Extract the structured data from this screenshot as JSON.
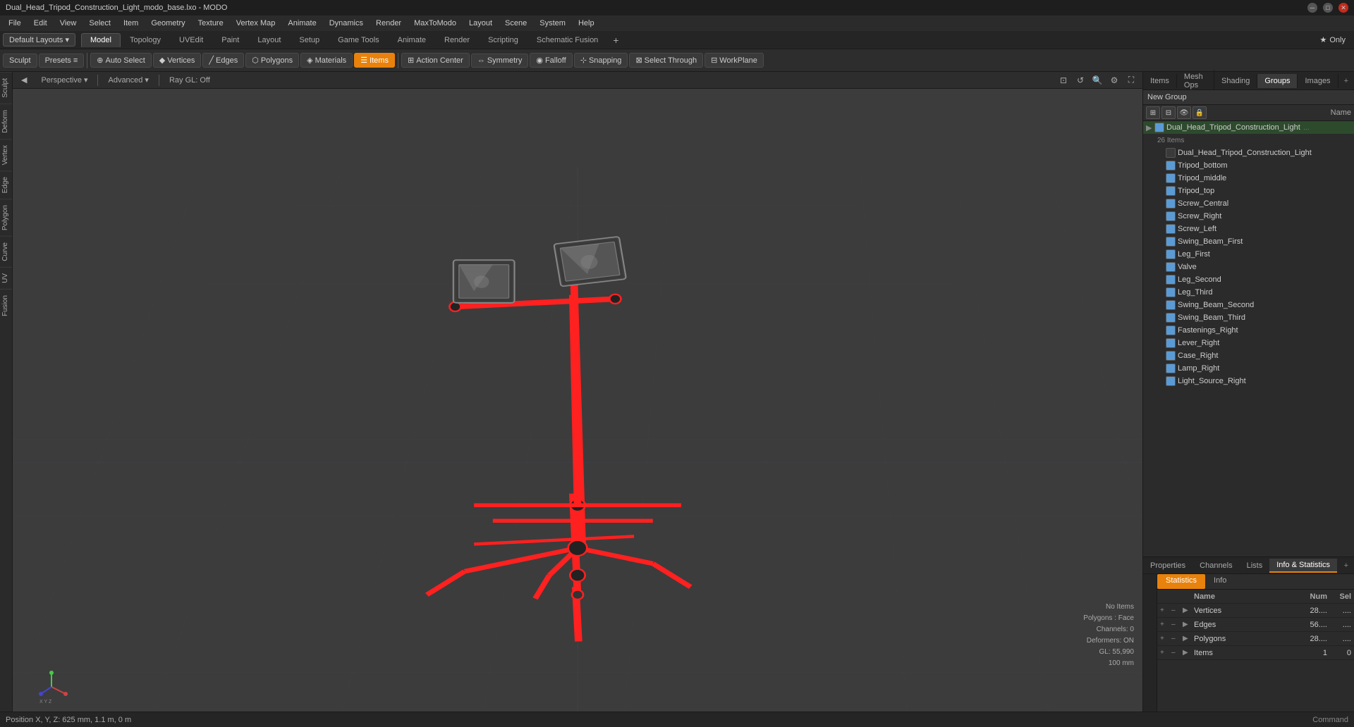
{
  "titlebar": {
    "title": "Dual_Head_Tripod_Construction_Light_modo_base.lxo - MODO",
    "controls": [
      "minimize",
      "maximize",
      "close"
    ]
  },
  "menubar": {
    "items": [
      "File",
      "Edit",
      "View",
      "Select",
      "Item",
      "Geometry",
      "Texture",
      "Vertex Map",
      "Animate",
      "Dynamics",
      "Render",
      "MaxToModo",
      "Layout",
      "Scene",
      "System",
      "Help"
    ]
  },
  "layoutbar": {
    "dropdown_label": "Default Layouts ▾",
    "tabs": [
      "Model",
      "Topology",
      "UVEdit",
      "Paint",
      "Layout",
      "Setup",
      "Game Tools",
      "Animate",
      "Render",
      "Scripting",
      "Schematic Fusion"
    ],
    "active_tab": "Model",
    "add_label": "+",
    "star_label": "★ Only"
  },
  "toolbar": {
    "sculpt_label": "Sculpt",
    "presets_label": "Presets",
    "presets_toggle": "III",
    "auto_select_label": "Auto Select",
    "vertices_label": "Vertices",
    "edges_label": "Edges",
    "polygons_label": "Polygons",
    "materials_label": "Materials",
    "items_label": "Items",
    "action_center_label": "Action Center",
    "symmetry_label": "Symmetry",
    "falloff_label": "Falloff",
    "snapping_label": "Snapping",
    "select_through_label": "Select Through",
    "workplane_label": "WorkPlane"
  },
  "viewport": {
    "view_label": "Perspective",
    "advanced_label": "Advanced",
    "ray_gl_label": "Ray GL: Off",
    "icons": [
      "fit-icon",
      "zoom-in-icon",
      "zoom-out-icon",
      "settings-icon",
      "expand-icon"
    ]
  },
  "left_sidebar": {
    "tabs": [
      "Sculpt",
      "Deform",
      "Vertex",
      "Edge",
      "Polygon",
      "Curve",
      "UV",
      "Fusion"
    ]
  },
  "right_panel": {
    "tabs": [
      "Items",
      "Mesh Ops",
      "Shading",
      "Groups",
      "Images"
    ],
    "active_tab": "Groups",
    "add_label": "+",
    "new_group_label": "New Group",
    "name_col": "Name",
    "groups": [
      {
        "label": "Dual_Head_Tripod_Construction_Light",
        "type": "group",
        "expanded": true,
        "selected": false,
        "children": [
          {
            "label": "26 Items",
            "type": "subheader"
          },
          {
            "label": "Dual_Head_Tripod_Construction_Light",
            "type": "item",
            "checked": false
          },
          {
            "label": "Tripod_bottom",
            "type": "item",
            "checked": true
          },
          {
            "label": "Tripod_middle",
            "type": "item",
            "checked": true
          },
          {
            "label": "Tripod_top",
            "type": "item",
            "checked": true
          },
          {
            "label": "Screw_Central",
            "type": "item",
            "checked": true
          },
          {
            "label": "Screw_Right",
            "type": "item",
            "checked": true
          },
          {
            "label": "Screw_Left",
            "type": "item",
            "checked": true
          },
          {
            "label": "Swing_Beam_First",
            "type": "item",
            "checked": true
          },
          {
            "label": "Leg_First",
            "type": "item",
            "checked": true
          },
          {
            "label": "Valve",
            "type": "item",
            "checked": true
          },
          {
            "label": "Leg_Second",
            "type": "item",
            "checked": true
          },
          {
            "label": "Leg_Third",
            "type": "item",
            "checked": true
          },
          {
            "label": "Swing_Beam_Second",
            "type": "item",
            "checked": true
          },
          {
            "label": "Swing_Beam_Third",
            "type": "item",
            "checked": true
          },
          {
            "label": "Fastenings_Right",
            "type": "item",
            "checked": true
          },
          {
            "label": "Lever_Right",
            "type": "item",
            "checked": true
          },
          {
            "label": "Case_Right",
            "type": "item",
            "checked": true
          },
          {
            "label": "Lamp_Right",
            "type": "item",
            "checked": true
          },
          {
            "label": "Light_Source_Right",
            "type": "item",
            "checked": true
          }
        ]
      }
    ]
  },
  "lower_panel": {
    "tabs": [
      "Properties",
      "Channels",
      "Lists",
      "Info & Statistics"
    ],
    "active_tab": "Info & Statistics",
    "add_label": "+",
    "stats_tabs": [
      "Statistics",
      "Info"
    ],
    "active_stats_tab": "Statistics",
    "columns": [
      "Name",
      "Num",
      "Sel"
    ],
    "rows": [
      {
        "name": "Vertices",
        "num": "28....",
        "sel": "...."
      },
      {
        "name": "Edges",
        "num": "56....",
        "sel": "...."
      },
      {
        "name": "Polygons",
        "num": "28....",
        "sel": "...."
      },
      {
        "name": "Items",
        "num": "1",
        "sel": "0"
      }
    ]
  },
  "statusbar": {
    "position": "Position X, Y, Z:  625 mm, 1.1 m, 0 m",
    "cmd_label": "Command"
  },
  "viewport_status": {
    "no_items": "No Items",
    "polygons": "Polygons : Face",
    "channels": "Channels: 0",
    "deformers": "Deformers: ON",
    "gl": "GL: 55,990",
    "units": "100 mm"
  }
}
